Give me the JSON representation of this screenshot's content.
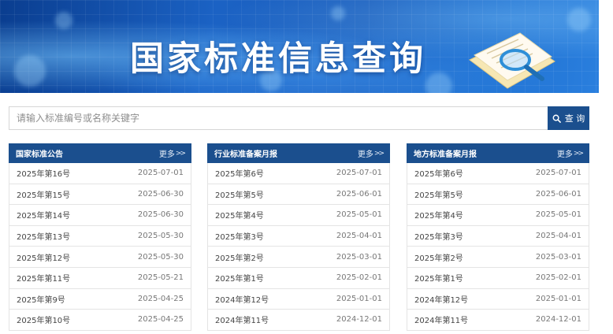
{
  "banner": {
    "title": "国家标准信息查询"
  },
  "search": {
    "placeholder": "请输入标准编号或名称关键字",
    "value": "",
    "button_label": "查 询"
  },
  "panels": [
    {
      "title": "国家标准公告",
      "more": "更多",
      "items": [
        {
          "name": "2025年第16号",
          "date": "2025-07-01"
        },
        {
          "name": "2025年第15号",
          "date": "2025-06-30"
        },
        {
          "name": "2025年第14号",
          "date": "2025-06-30"
        },
        {
          "name": "2025年第13号",
          "date": "2025-05-30"
        },
        {
          "name": "2025年第12号",
          "date": "2025-05-30"
        },
        {
          "name": "2025年第11号",
          "date": "2025-05-21"
        },
        {
          "name": "2025年第9号",
          "date": "2025-04-25"
        },
        {
          "name": "2025年第10号",
          "date": "2025-04-25"
        }
      ]
    },
    {
      "title": "行业标准备案月报",
      "more": "更多",
      "items": [
        {
          "name": "2025年第6号",
          "date": "2025-07-01"
        },
        {
          "name": "2025年第5号",
          "date": "2025-06-01"
        },
        {
          "name": "2025年第4号",
          "date": "2025-05-01"
        },
        {
          "name": "2025年第3号",
          "date": "2025-04-01"
        },
        {
          "name": "2025年第2号",
          "date": "2025-03-01"
        },
        {
          "name": "2025年第1号",
          "date": "2025-02-01"
        },
        {
          "name": "2024年第12号",
          "date": "2025-01-01"
        },
        {
          "name": "2024年第11号",
          "date": "2024-12-01"
        }
      ]
    },
    {
      "title": "地方标准备案月报",
      "more": "更多",
      "items": [
        {
          "name": "2025年第6号",
          "date": "2025-07-01"
        },
        {
          "name": "2025年第5号",
          "date": "2025-06-01"
        },
        {
          "name": "2025年第4号",
          "date": "2025-05-01"
        },
        {
          "name": "2025年第3号",
          "date": "2025-04-01"
        },
        {
          "name": "2025年第2号",
          "date": "2025-03-01"
        },
        {
          "name": "2025年第1号",
          "date": "2025-02-01"
        },
        {
          "name": "2024年第12号",
          "date": "2025-01-01"
        },
        {
          "name": "2024年第11号",
          "date": "2024-12-01"
        }
      ]
    }
  ],
  "colors": {
    "header_bg": "#1b4f8e",
    "banner_bg": "#1b62c4"
  },
  "icons": {
    "search": "search-icon",
    "more": "double-chevron-right-icon",
    "banner_art": "document-magnifier-icon"
  }
}
